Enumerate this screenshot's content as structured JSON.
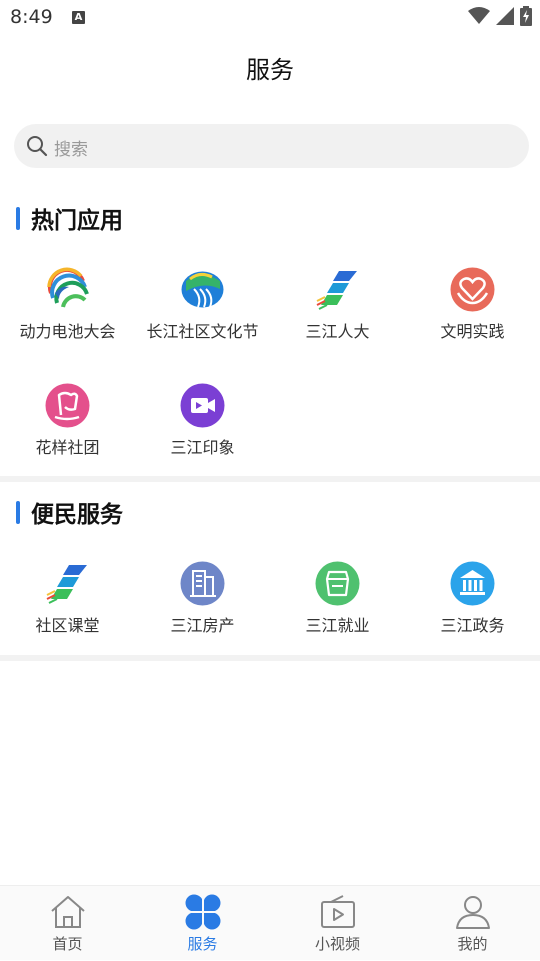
{
  "status_bar": {
    "time": "8:49",
    "notification_badge": "A"
  },
  "header": {
    "title": "服务"
  },
  "search": {
    "placeholder": "搜索"
  },
  "sections": [
    {
      "title": "热门应用",
      "items": [
        {
          "label": "动力电池大会",
          "icon": "power-battery-conference-icon"
        },
        {
          "label": "长江社区文化节",
          "icon": "yangtze-community-festival-icon"
        },
        {
          "label": "三江人大",
          "icon": "sanjiang-congress-icon"
        },
        {
          "label": "文明实践",
          "icon": "civilization-practice-icon"
        },
        {
          "label": "花样社团",
          "icon": "flower-club-icon"
        },
        {
          "label": "三江印象",
          "icon": "sanjiang-video-icon"
        }
      ]
    },
    {
      "title": "便民服务",
      "items": [
        {
          "label": "社区课堂",
          "icon": "community-classroom-icon"
        },
        {
          "label": "三江房产",
          "icon": "sanjiang-real-estate-icon"
        },
        {
          "label": "三江就业",
          "icon": "sanjiang-employment-icon"
        },
        {
          "label": "三江政务",
          "icon": "sanjiang-government-icon"
        }
      ]
    }
  ],
  "tab_bar": {
    "items": [
      {
        "label": "首页",
        "icon": "home-icon",
        "active": false
      },
      {
        "label": "服务",
        "icon": "services-icon",
        "active": true
      },
      {
        "label": "小视频",
        "icon": "short-video-icon",
        "active": false
      },
      {
        "label": "我的",
        "icon": "profile-icon",
        "active": false
      }
    ]
  },
  "colors": {
    "accent": "#2a7be4",
    "pink": "#e4508c",
    "coral": "#e86a5a",
    "purple": "#7b3fd4",
    "slate_blue": "#6e86c8",
    "green": "#4fc16f",
    "sky_blue": "#2ba3ea"
  }
}
